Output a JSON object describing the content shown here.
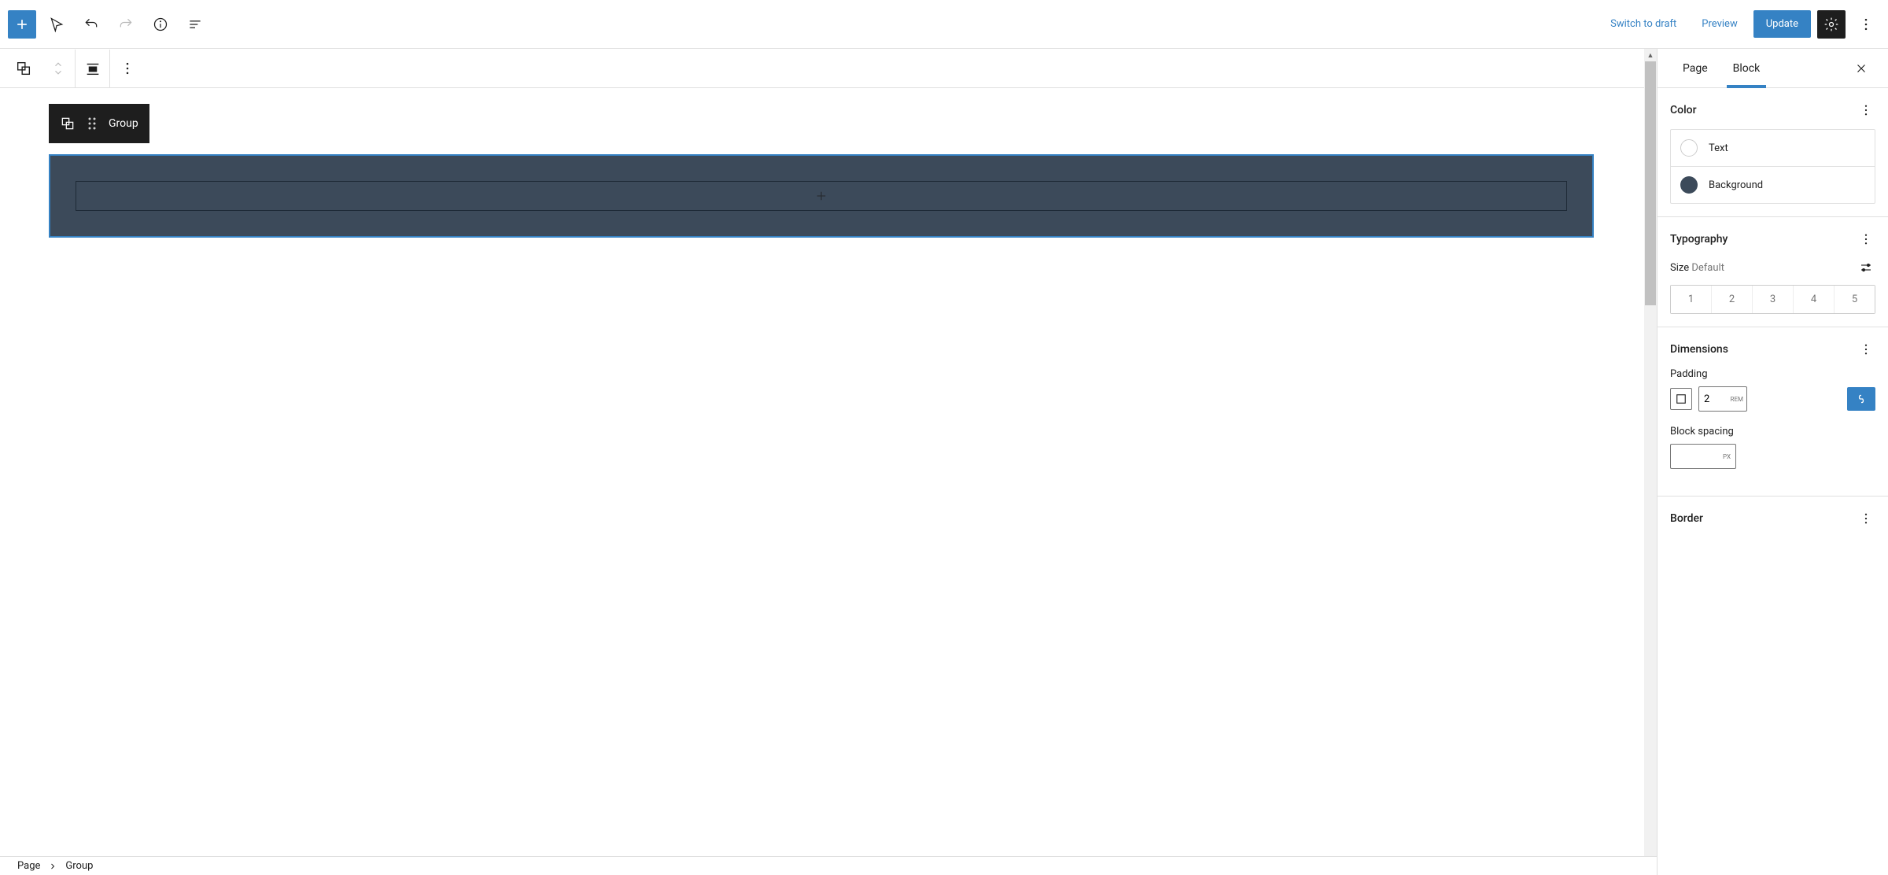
{
  "header": {
    "switch_to_draft": "Switch to draft",
    "preview": "Preview",
    "update": "Update"
  },
  "block_label": {
    "name": "Group"
  },
  "sidebar": {
    "tabs": {
      "page": "Page",
      "block": "Block"
    },
    "color": {
      "title": "Color",
      "text": "Text",
      "background": "Background",
      "background_hex": "#3c4a5a"
    },
    "typography": {
      "title": "Typography",
      "size_label": "Size",
      "size_value": "Default",
      "sizes": [
        "1",
        "2",
        "3",
        "4",
        "5"
      ]
    },
    "dimensions": {
      "title": "Dimensions",
      "padding_label": "Padding",
      "padding_value": "2",
      "padding_unit": "REM",
      "block_spacing_label": "Block spacing",
      "block_spacing_unit": "PX"
    },
    "border": {
      "title": "Border"
    }
  },
  "breadcrumb": {
    "root": "Page",
    "current": "Group"
  }
}
